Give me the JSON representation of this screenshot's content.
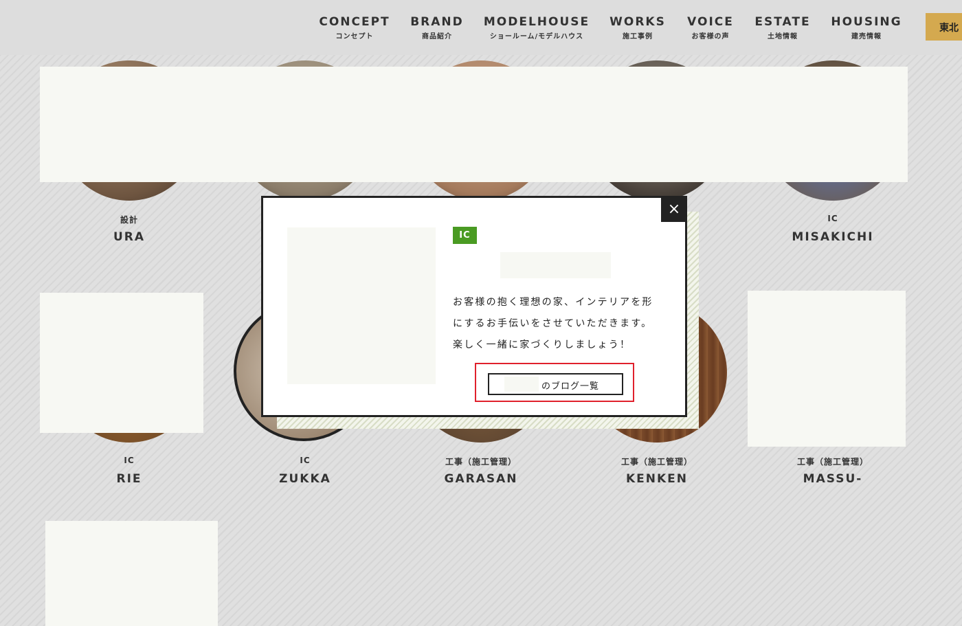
{
  "header": {
    "nav": [
      {
        "en": "CONCEPT",
        "ja": "コンセプト"
      },
      {
        "en": "BRAND",
        "ja": "商品紹介"
      },
      {
        "en": "MODELHOUSE",
        "ja": "ショールーム/モデルハウス"
      },
      {
        "en": "WORKS",
        "ja": "施工事例"
      },
      {
        "en": "VOICE",
        "ja": "お客様の声"
      },
      {
        "en": "ESTATE",
        "ja": "土地情報"
      },
      {
        "en": "HOUSING",
        "ja": "建売情報"
      }
    ],
    "region_button": "東北"
  },
  "staff": [
    {
      "role": "設計",
      "name": "URA"
    },
    {
      "role": "IC",
      "name": "MISAKICHI"
    },
    {
      "role": "IC",
      "name": "RIE"
    },
    {
      "role": "IC",
      "name": "ZUKKA"
    },
    {
      "role": "工事（施工管理）",
      "name": "GARASAN"
    },
    {
      "role": "工事（施工管理）",
      "name": "KENKEN"
    },
    {
      "role": "工事（施工管理）",
      "name": "MASSU-"
    }
  ],
  "modal": {
    "close_label": "×",
    "badge": "IC",
    "description": "お客様の抱く理想の家、インテリアを形にするお手伝いをさせていただきます。楽しく一緒に家づくりしましょう！",
    "blog_button_label": "のブログ一覧"
  }
}
